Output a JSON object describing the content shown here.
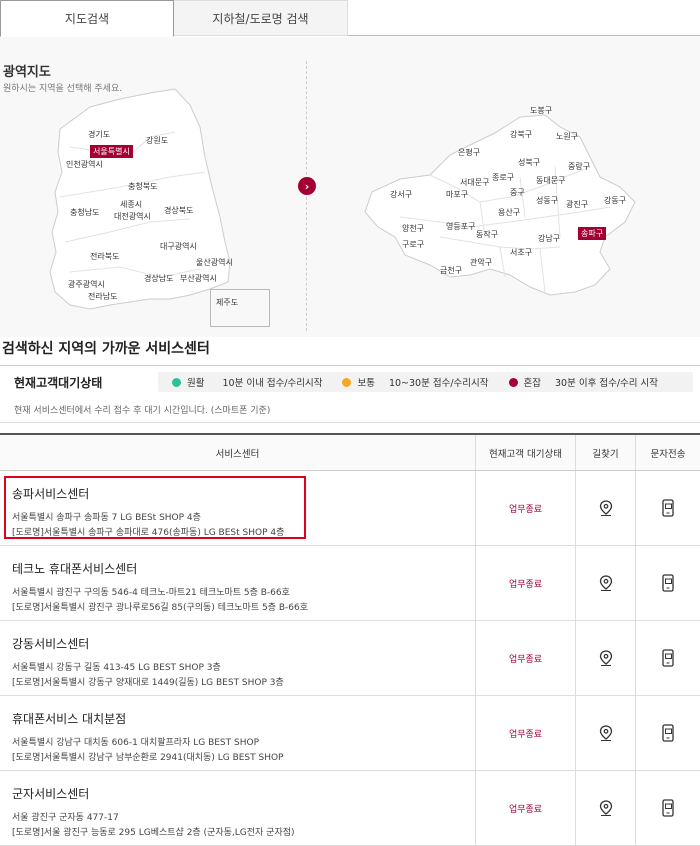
{
  "tabs": [
    "지도검색",
    "지하철/도로명 검색"
  ],
  "map": {
    "title": "광역지도",
    "hint": "원하시는 지역을 선택해 주세요.",
    "provinces": [
      "경기도",
      "서울특별시",
      "강원도",
      "인천광역시",
      "충청북도",
      "세종시",
      "충청남도",
      "대전광역시",
      "경상북도",
      "전라북도",
      "대구광역시",
      "울산광역시",
      "경상남도",
      "부산광역시",
      "광주광역시",
      "전라남도",
      "제주도"
    ],
    "selected_province": "서울특별시",
    "districts": [
      "도봉구",
      "강북구",
      "노원구",
      "은평구",
      "성북구",
      "중랑구",
      "종로구",
      "동대문구",
      "강서구",
      "서대문구",
      "마포구",
      "중구",
      "성동구",
      "광진구",
      "강동구",
      "용산구",
      "양천구",
      "영등포구",
      "동작구",
      "구로구",
      "강남구",
      "송파구",
      "서초구",
      "관악구",
      "금천구"
    ],
    "selected_district": "송파구",
    "arrow": "›"
  },
  "section_title": "검색하신 지역의 가까운 서비스센터",
  "status": {
    "title": "현재고객대기상태",
    "legend": [
      {
        "label": "원활",
        "desc": "10분 이내 접수/수리시작",
        "color": "#2bbf9a"
      },
      {
        "label": "보통",
        "desc": "10~30분 접수/수리시작",
        "color": "#f5a623"
      },
      {
        "label": "혼잡",
        "desc": "30분 이후 접수/수리 시작",
        "color": "#a50034"
      }
    ],
    "note": "현재 서비스센터에서 수리 접수 후 대기 시간입니다. (스마트폰 기준)"
  },
  "table": {
    "headers": [
      "서비스센터",
      "현재고객 대기상태",
      "길찾기",
      "문자전송"
    ],
    "rows": [
      {
        "name": "송파서비스센터",
        "addr1": "서울특별시 송파구 송파동 7 LG BESt SHOP 4층",
        "addr2": "[도로명]서울특별시 송파구 송파대로 476(송파동) LG BESt SHOP 4층",
        "status": "업무종료"
      },
      {
        "name": "테크노 휴대폰서비스센터",
        "addr1": "서울특별시 광진구 구의동 546-4 테크노-마트21 테크노마트 5층 B-66호",
        "addr2": "[도로명]서울특별시 광진구 광나루로56길 85(구의동) 테크노마트 5층 B-66호",
        "status": "업무종료"
      },
      {
        "name": "강동서비스센터",
        "addr1": "서울특별시 강동구 길동 413-45 LG BEST SHOP 3층",
        "addr2": "[도로명]서울특별시 강동구 양재대로 1449(길동) LG BEST SHOP 3층",
        "status": "업무종료"
      },
      {
        "name": "휴대폰서비스 대치분점",
        "addr1": "서울특별시 강남구 대치동 606-1 대치팔프라자 LG BEST SHOP",
        "addr2": "[도로명]서울특별시 강남구 남부순환로 2941(대치동) LG BEST SHOP",
        "status": "업무종료"
      },
      {
        "name": "군자서비스센터",
        "addr1": "서울 광진구 군자동 477-17",
        "addr2": "[도로명]서울 광진구 능동로 295 LG베스트샵 2층 (군자동,LG전자 군자점)",
        "status": "업무종료"
      }
    ]
  }
}
